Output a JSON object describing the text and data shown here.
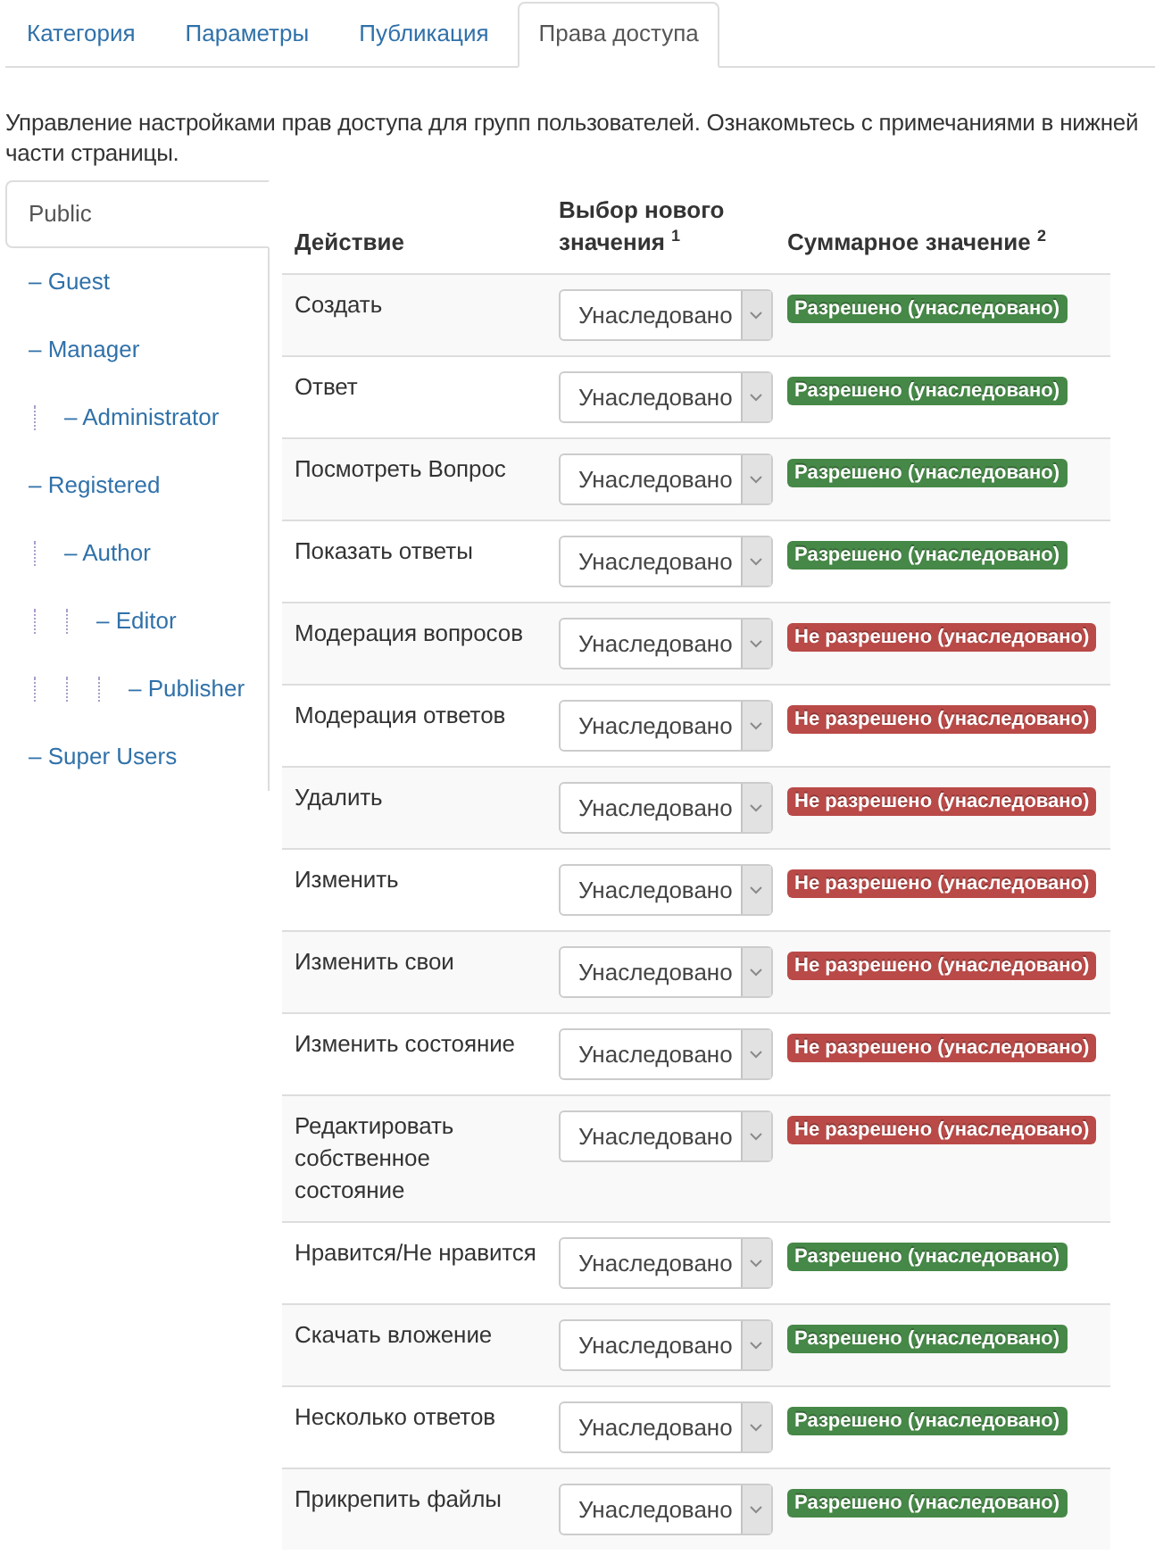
{
  "tabs": [
    {
      "label": "Категория",
      "selected": false
    },
    {
      "label": "Параметры",
      "selected": false
    },
    {
      "label": "Публикация",
      "selected": false
    },
    {
      "label": "Права доступа",
      "selected": true
    }
  ],
  "description": "Управление настройками прав доступа для групп пользователей. Ознакомьтесь с примечаниями в нижней части страницы.",
  "groups": [
    {
      "label": "Public",
      "selected": true,
      "children": [
        {
          "label": "– Guest",
          "selected": false
        },
        {
          "label": "– Manager",
          "selected": false,
          "children": [
            {
              "label": "– Administrator",
              "selected": false
            }
          ]
        },
        {
          "label": "– Registered",
          "selected": false,
          "children": [
            {
              "label": "– Author",
              "selected": false,
              "children": [
                {
                  "label": "– Editor",
                  "selected": false,
                  "children": [
                    {
                      "label": "– Publisher",
                      "selected": false
                    }
                  ]
                }
              ]
            }
          ]
        },
        {
          "label": "– Super Users",
          "selected": false
        }
      ]
    }
  ],
  "table": {
    "columns": [
      "Действие",
      "Выбор нового значения $^{1}$",
      "Суммарное значение $^{2}$"
    ],
    "rows": [
      {
        "action": "Создать",
        "setting": "Унаследовано",
        "result": "Разрешено (унаследовано)",
        "allowed": true
      },
      {
        "action": "Ответ",
        "setting": "Унаследовано",
        "result": "Разрешено (унаследовано)",
        "allowed": true
      },
      {
        "action": "Посмотреть Вопрос",
        "setting": "Унаследовано",
        "result": "Разрешено (унаследовано)",
        "allowed": true
      },
      {
        "action": "Показать ответы",
        "setting": "Унаследовано",
        "result": "Разрешено (унаследовано)",
        "allowed": true
      },
      {
        "action": "Модерация вопросов",
        "setting": "Унаследовано",
        "result": "Не разрешено (унаследовано)",
        "allowed": false
      },
      {
        "action": "Модерация ответов",
        "setting": "Унаследовано",
        "result": "Не разрешено (унаследовано)",
        "allowed": false
      },
      {
        "action": "Удалить",
        "setting": "Унаследовано",
        "result": "Не разрешено (унаследовано)",
        "allowed": false
      },
      {
        "action": "Изменить",
        "setting": "Унаследовано",
        "result": "Не разрешено (унаследовано)",
        "allowed": false
      },
      {
        "action": "Изменить свои",
        "setting": "Унаследовано",
        "result": "Не разрешено (унаследовано)",
        "allowed": false
      },
      {
        "action": "Изменить состояние",
        "setting": "Унаследовано",
        "result": "Не разрешено (унаследовано)",
        "allowed": false
      },
      {
        "action": "Редактировать собственное состояние",
        "setting": "Унаследовано",
        "result": "Не разрешено (унаследовано)",
        "allowed": false
      },
      {
        "action": "Нравится/Не нравится",
        "setting": "Унаследовано",
        "result": "Разрешено (унаследовано)",
        "allowed": true
      },
      {
        "action": "Скачать вложение",
        "setting": "Унаследовано",
        "result": "Разрешено (унаследовано)",
        "allowed": true
      },
      {
        "action": "Несколько ответов",
        "setting": "Унаследовано",
        "result": "Разрешено (унаследовано)",
        "allowed": true
      },
      {
        "action": "Прикрепить файлы",
        "setting": "Унаследовано",
        "result": "Разрешено (унаследовано)",
        "allowed": true
      }
    ]
  }
}
